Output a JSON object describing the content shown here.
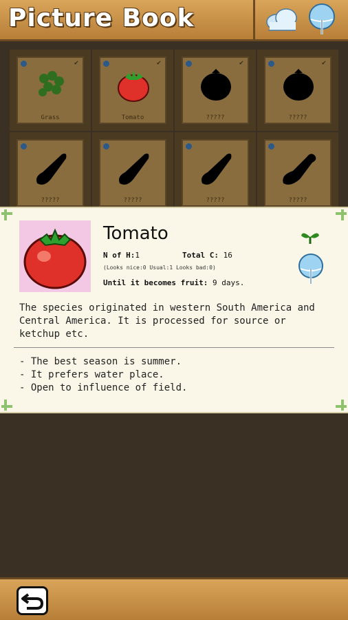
{
  "header": {
    "title": "Picture Book",
    "weather_icon": "cloud-icon",
    "umbrella_icon": "umbrella-icon"
  },
  "grid": {
    "cells": [
      {
        "label": "Grass",
        "shape": "grass",
        "mark": "✔"
      },
      {
        "label": "Tomato",
        "shape": "tomato",
        "mark": "✔"
      },
      {
        "label": "?????",
        "shape": "round",
        "mark": "✔"
      },
      {
        "label": "?????",
        "shape": "round",
        "mark": "✔"
      },
      {
        "label": "?????",
        "shape": "cucumber",
        "mark": ""
      },
      {
        "label": "?????",
        "shape": "cucumber",
        "mark": ""
      },
      {
        "label": "?????",
        "shape": "cucumber",
        "mark": ""
      },
      {
        "label": "?????",
        "shape": "eggplant",
        "mark": ""
      },
      {
        "label": "?????",
        "shape": "round",
        "mark": ""
      },
      {
        "label": "?????",
        "shape": "round",
        "mark": ""
      },
      {
        "label": "?????",
        "shape": "round",
        "mark": ""
      },
      {
        "label": "?????",
        "shape": "round",
        "mark": ""
      },
      {
        "label": "?????",
        "shape": "pumpkin",
        "mark": "✔"
      },
      {
        "label": "?????",
        "shape": "pumpkin",
        "mark": "✔"
      },
      {
        "label": "?????",
        "shape": "corn",
        "mark": "✔"
      },
      {
        "label": "?????",
        "shape": "corn",
        "mark": "✔"
      }
    ]
  },
  "detail": {
    "name": "Tomato",
    "n_of_h_label": "N of H:",
    "n_of_h_value": "1",
    "total_c_label": "Total C:",
    "total_c_value": "16",
    "breakdown": "(Looks nice:0 Usual:1 Looks bad:0)",
    "until_label": "Until it becomes fruit:",
    "until_value": "9 days.",
    "description": "The species originated in western South America and Central America. It is processed for source or ketchup etc.",
    "tips": [
      "- The best season is summer.",
      "- It prefers water place.",
      "- Open to influence of field."
    ]
  },
  "footer": {
    "back_icon": "back-arrow-icon"
  },
  "colors": {
    "wood": "#c68e44",
    "panel": "#fbf7e8",
    "thumb_bg": "#f2c8e4",
    "tomato_red": "#e0302a"
  }
}
